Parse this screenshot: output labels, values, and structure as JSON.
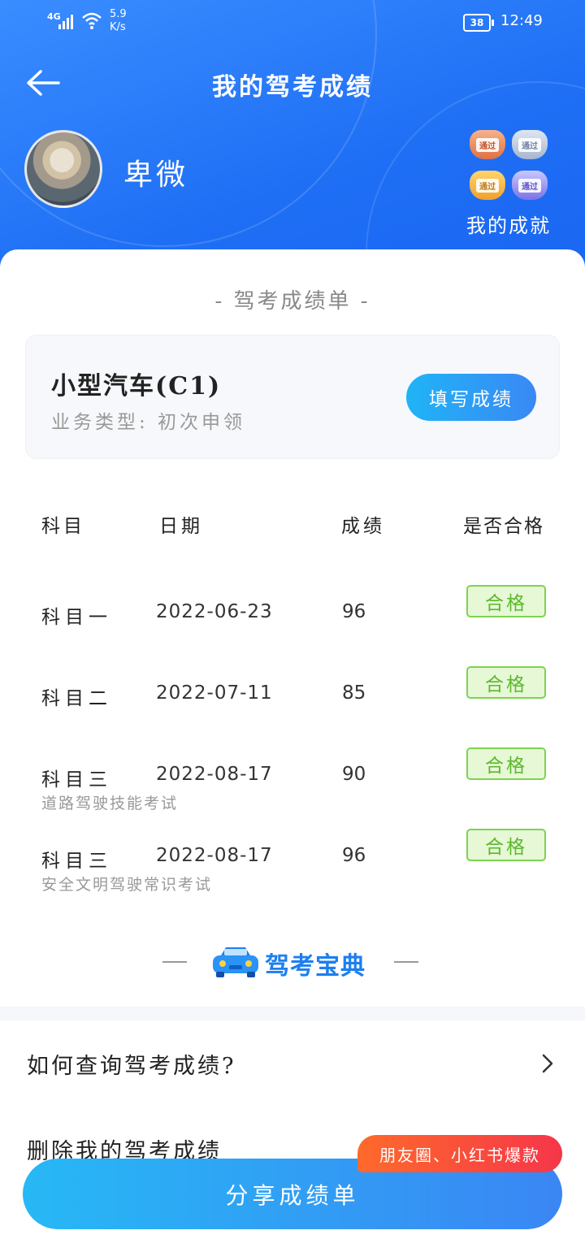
{
  "status_bar": {
    "network": "4G",
    "speed_value": "5.9",
    "speed_unit": "K/s",
    "battery": "38",
    "time": "12:49"
  },
  "header": {
    "title": "我的驾考成绩",
    "user_name": "卑微",
    "achievements_label": "我的成就",
    "badge_text": "通过"
  },
  "sheet": {
    "title": "- 驾考成绩单 -",
    "license_type": "小型汽车(C1)",
    "business_type": "业务类型: 初次申领",
    "fill_button": "填写成绩"
  },
  "table": {
    "headers": [
      "科目",
      "日期",
      "成绩",
      "是否合格"
    ],
    "rows": [
      {
        "subject": "科目一",
        "date": "2022-06-23",
        "score": "96",
        "result": "合格",
        "note": ""
      },
      {
        "subject": "科目二",
        "date": "2022-07-11",
        "score": "85",
        "result": "合格",
        "note": ""
      },
      {
        "subject": "科目三",
        "date": "2022-08-17",
        "score": "90",
        "result": "合格",
        "note": "道路驾驶技能考试"
      },
      {
        "subject": "科目三",
        "date": "2022-08-17",
        "score": "96",
        "result": "合格",
        "note": "安全文明驾驶常识考试"
      }
    ]
  },
  "brand": {
    "name": "驾考宝典",
    "color": "#1c7ff0"
  },
  "links": {
    "faq": "如何查询驾考成绩?",
    "delete": "删除我的驾考成绩"
  },
  "footer": {
    "share_button": "分享成绩单",
    "promo_tag": "朋友圈、小红书爆款"
  },
  "colors": {
    "header_blue": "#1f6ff5",
    "pass_green": "#5cb82c",
    "promo_red": "#f5364a"
  }
}
